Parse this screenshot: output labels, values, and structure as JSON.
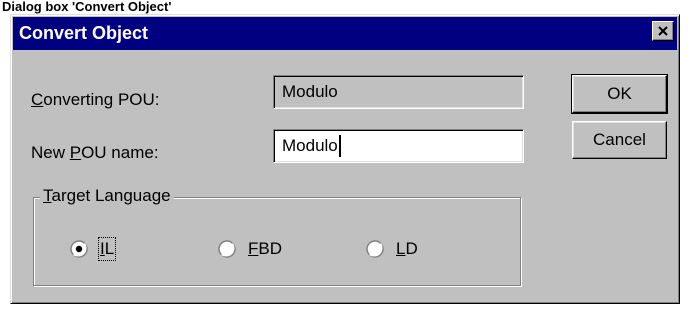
{
  "caption": "Dialog box 'Convert Object'",
  "dialog": {
    "title": "Convert Object",
    "converting_pou_label": {
      "pre": "",
      "accel": "C",
      "post": "onverting POU:"
    },
    "converting_pou_value": "Modulo",
    "new_pou_label": {
      "pre": "New ",
      "accel": "P",
      "post": "OU name:"
    },
    "new_pou_value": "Modulo",
    "ok_label": "OK",
    "cancel_label": "Cancel",
    "target_language": {
      "legend": {
        "pre": "",
        "accel": "T",
        "post": "arget Language"
      },
      "options": [
        {
          "pre": "",
          "accel": "I",
          "post": "L",
          "selected": true
        },
        {
          "pre": "",
          "accel": "F",
          "post": "BD",
          "selected": false
        },
        {
          "pre": "",
          "accel": "L",
          "post": "D",
          "selected": false
        }
      ]
    }
  },
  "colors": {
    "titlebar": "#000080",
    "face": "#c0c0c0",
    "field_bg": "#ffffff"
  }
}
